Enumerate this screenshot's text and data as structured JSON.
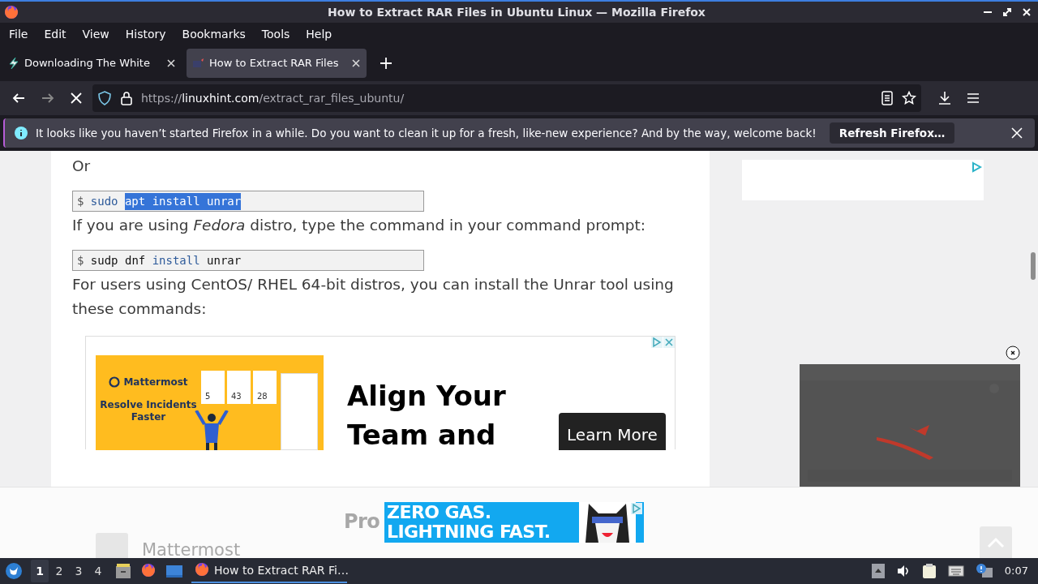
{
  "window": {
    "title": "How to Extract RAR Files in Ubuntu Linux — Mozilla Firefox"
  },
  "menu": [
    "File",
    "Edit",
    "View",
    "History",
    "Bookmarks",
    "Tools",
    "Help"
  ],
  "tabs": [
    {
      "label": "Downloading The White",
      "selected": false,
      "kind": "bolt"
    },
    {
      "label": "How to Extract RAR Files",
      "selected": true,
      "kind": "site"
    }
  ],
  "address": {
    "scheme": "https://",
    "host": "linuxhint.com",
    "path": "/extract_rar_files_ubuntu/"
  },
  "notification": {
    "message": "It looks like you haven’t started Firefox in a while. Do you want to clean it up for a fresh, like-new experience? And by the way, welcome back!",
    "button": "Refresh Firefox…"
  },
  "article": [
    {
      "kind": "paragraph",
      "text": "Or"
    },
    {
      "kind": "code",
      "tokens": [
        {
          "text": "$",
          "kind": "prompt",
          "selected": false
        },
        {
          "text": "sudo",
          "kind": "keyword",
          "selected": false
        },
        {
          "text": "apt install unrar",
          "kind": "plain",
          "selected": true
        }
      ]
    },
    {
      "kind": "paragraph",
      "text": "If you are using *Fedora* distro, type the command in your command prompt:"
    },
    {
      "kind": "code",
      "tokens": [
        {
          "text": "$",
          "kind": "prompt",
          "selected": false
        },
        {
          "text": "sudp dnf",
          "kind": "plain",
          "selected": false
        },
        {
          "text": "install",
          "kind": "keyword",
          "selected": false
        },
        {
          "text": "unrar",
          "kind": "plain",
          "selected": false
        }
      ]
    },
    {
      "kind": "paragraph",
      "text": "For users using CentOS/ RHEL 64-bit distros, you can install the Unrar tool using these commands:"
    }
  ],
  "ad": {
    "image": {
      "brand": "Mattermost",
      "tagline": "Resolve Incidents Faster",
      "stats": [
        "5",
        "43",
        "28"
      ]
    },
    "headline": [
      "Align Your",
      "Team and"
    ],
    "headline_rest": "Pro",
    "cta": "Learn More",
    "advertiser": "Mattermost"
  },
  "sticky_ad": {
    "lines": [
      "ZERO GAS.",
      "LIGHTNING FAST."
    ]
  },
  "taskbar": {
    "workspaces": [
      {
        "label": "1",
        "selected": true
      },
      {
        "label": "2",
        "selected": false
      },
      {
        "label": "3",
        "selected": false
      },
      {
        "label": "4",
        "selected": false
      }
    ],
    "task": {
      "label": "How to Extract RAR Fi…",
      "selected": true
    },
    "clock": "0:07"
  }
}
